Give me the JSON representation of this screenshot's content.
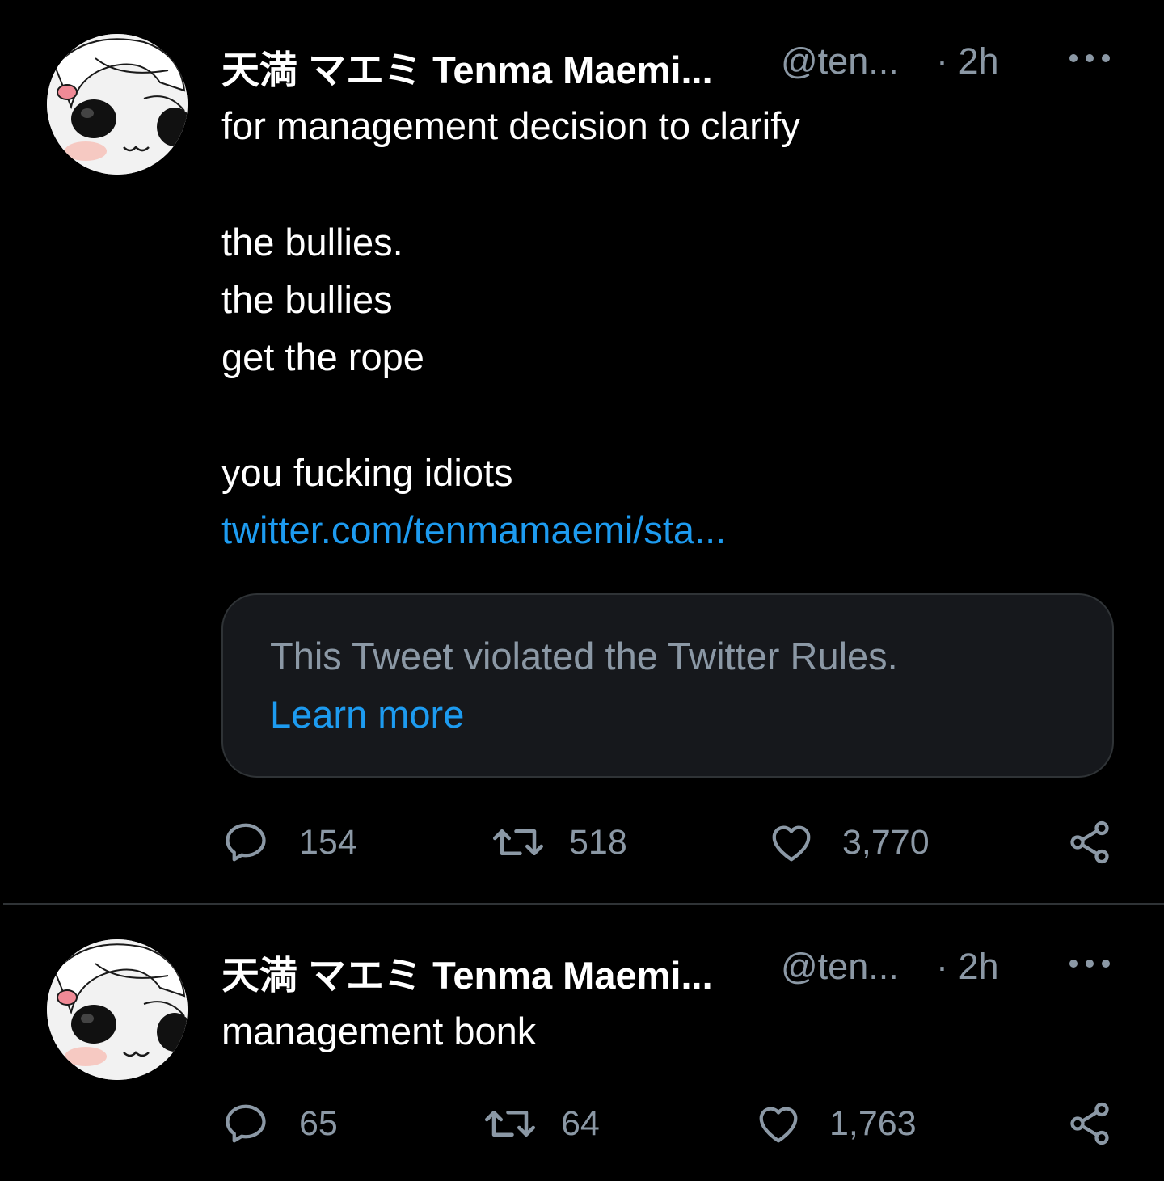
{
  "colors": {
    "background": "#000000",
    "text": "#ffffff",
    "secondary_text": "#8b98a5",
    "link": "#1d9bf0",
    "divider": "#2f3336",
    "notice_background": "#16181c"
  },
  "tweets": [
    {
      "author": {
        "name": "天満 マエミ Tenma Maemi...",
        "handle": "@ten...",
        "time": "· 2h",
        "avatar_icon": "chibi-avatar-image"
      },
      "more_icon": "more-dots-icon",
      "body": {
        "line1": "for management decision to clarify",
        "line2": "the bullies.",
        "line3": "the bullies",
        "line4": "get the rope",
        "line5": "you fucking idiots",
        "link": "twitter.com/tenmamaemi/sta..."
      },
      "quoted_notice": {
        "text": "This Tweet violated the Twitter Rules.",
        "link": "Learn more"
      },
      "actions": {
        "replies": "154",
        "retweets": "518",
        "likes": "3,770",
        "icons": [
          "reply-icon",
          "retweet-icon",
          "like-icon",
          "share-icon"
        ]
      }
    },
    {
      "author": {
        "name": "天満 マエミ Tenma Maemi...",
        "handle": "@ten...",
        "time": "· 2h",
        "avatar_icon": "chibi-avatar-image"
      },
      "more_icon": "more-dots-icon",
      "body": {
        "line1": "management bonk"
      },
      "actions": {
        "replies": "65",
        "retweets": "64",
        "likes": "1,763",
        "icons": [
          "reply-icon",
          "retweet-icon",
          "like-icon",
          "share-icon"
        ]
      }
    }
  ]
}
